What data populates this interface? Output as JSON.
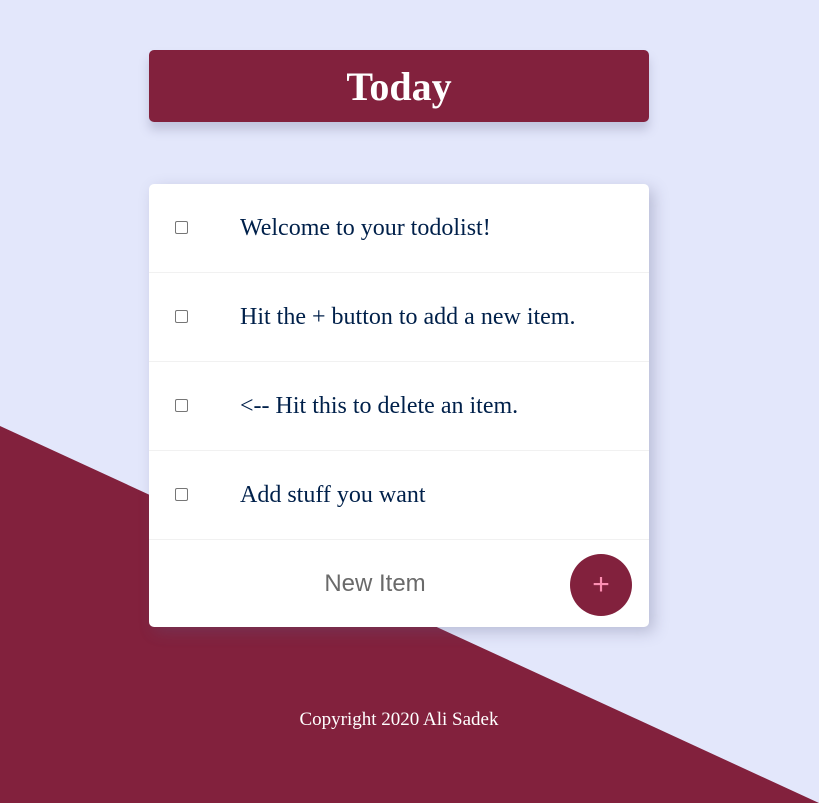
{
  "heading": {
    "title": "Today"
  },
  "items": [
    {
      "text": "Welcome to your todolist!",
      "checked": false
    },
    {
      "text": "Hit the + button to add a new item.",
      "checked": false
    },
    {
      "text": "<-- Hit this to delete an item.",
      "checked": false
    },
    {
      "text": "Add stuff you want",
      "checked": false
    }
  ],
  "new_item": {
    "placeholder": "New Item",
    "add_label": "+"
  },
  "footer": {
    "copyright": "Copyright 2020 Ali Sadek"
  },
  "colors": {
    "background": "#e3e7fb",
    "accent": "#82213d",
    "item_text": "#00204a",
    "add_icon": "#fc8fb2"
  }
}
